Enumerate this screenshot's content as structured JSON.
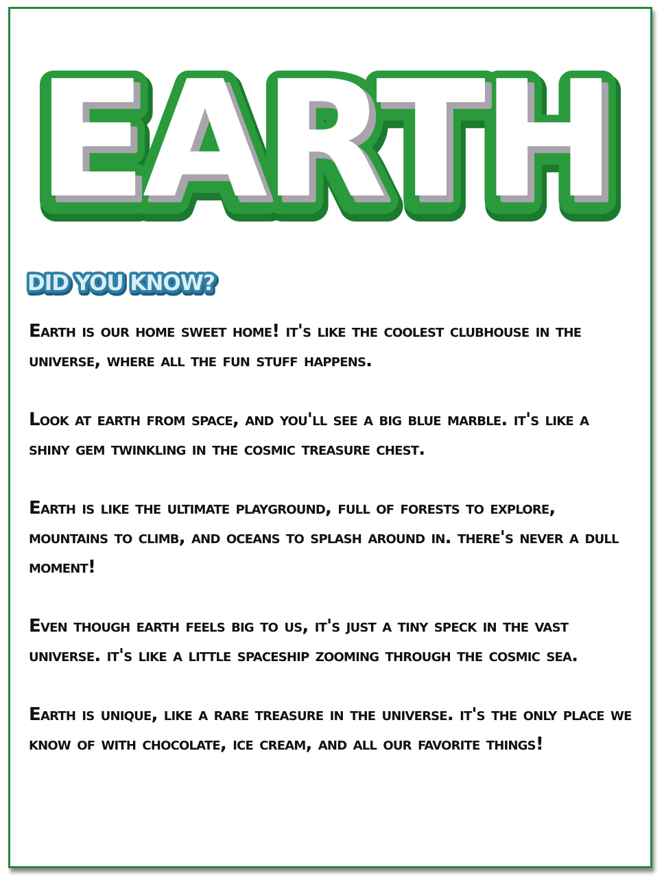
{
  "colors": {
    "border": "#23873a",
    "title_green": "#2a9a3c",
    "title_green_dark": "#1b7a2e",
    "title_letter": "#ffffff",
    "title_shadow": "#a9a4ab",
    "badge_fill": "#d9eef5",
    "badge_outline": "#2f7fa6",
    "text": "#111111"
  },
  "title": "EARTH",
  "badge": "DID YOU KNOW?",
  "paragraphs": [
    "Earth is our home sweet home! It's like the coolest clubhouse in the universe, where all the fun stuff happens.",
    "Look at Earth from space, and you'll see a big blue marble. It's like a shiny gem twinkling in the cosmic treasure chest.",
    "Earth is like the ultimate playground, full of forests to explore, mountains to climb, and oceans to splash around in. There's never a dull moment!",
    "Even though Earth feels big to us, it's just a tiny speck in the vast universe. It's like a little spaceship zooming through the cosmic sea.",
    "Earth is unique, like a rare treasure in the universe. It's the only place we know of with chocolate, ice cream, and all our favorite things!"
  ]
}
